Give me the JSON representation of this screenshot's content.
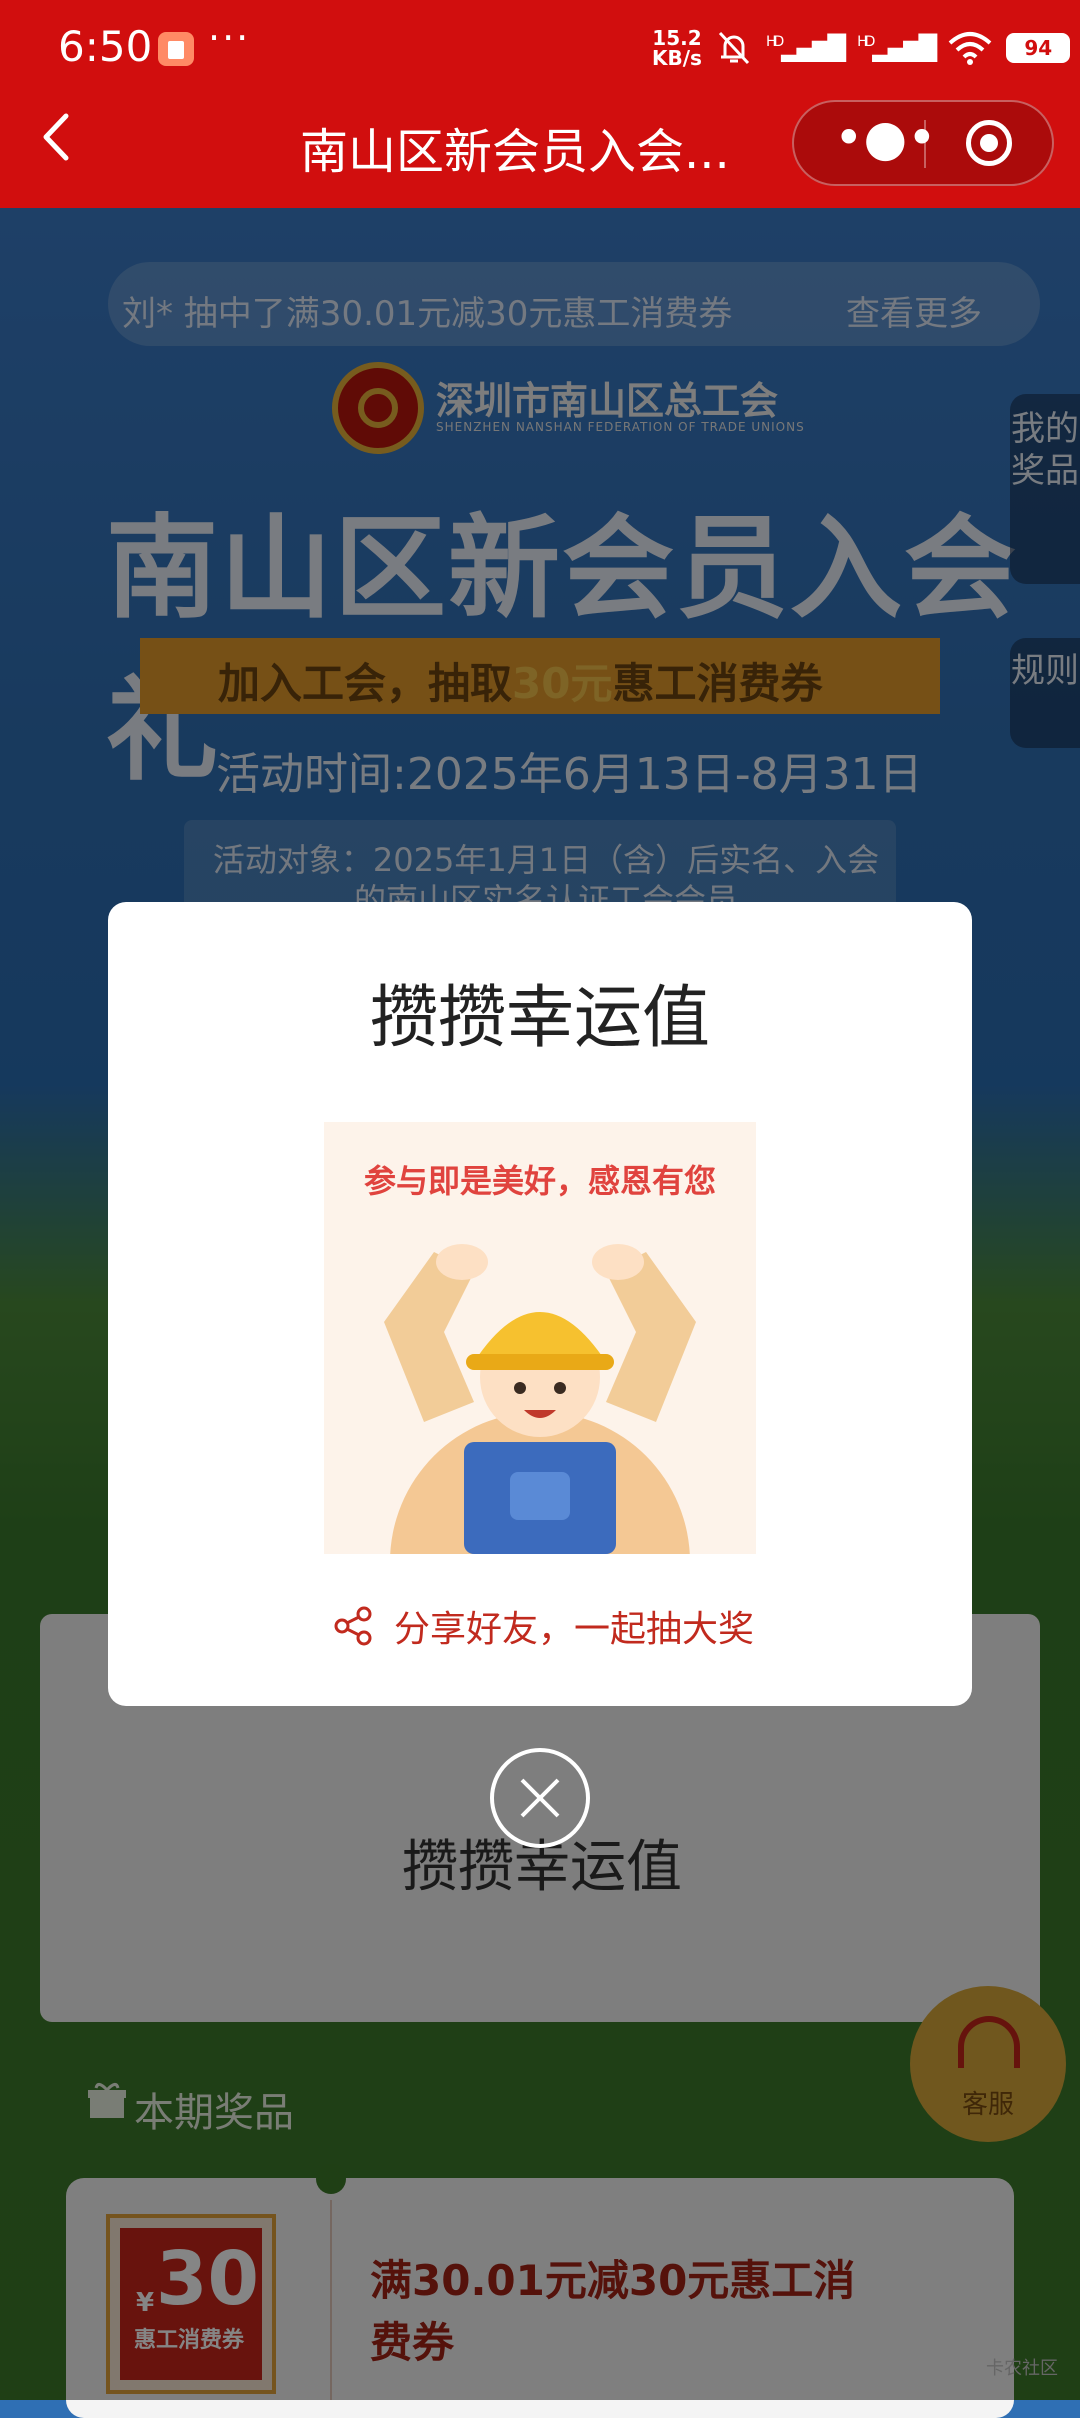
{
  "status_bar": {
    "time": "6:50",
    "net_speed_top": "15.2",
    "net_speed_unit": "KB/s",
    "signal_1_label": "HD",
    "signal_2_label": "HD",
    "battery": "94"
  },
  "header": {
    "title": "南山区新会员入会..."
  },
  "background": {
    "ticker": {
      "text": "刘* 抽中了满30.01元减30元惠工消费券",
      "more": "查看更多"
    },
    "org_name": "深圳市南山区总工会",
    "org_name_en": "SHENZHEN NANSHAN FEDERATION OF TRADE UNIONS",
    "hero_title": "南山区新会员入会礼",
    "banner": {
      "before": "加入工会，抽取",
      "highlight": "30元",
      "after": "惠工消费券"
    },
    "activity_time": "活动时间:2025年6月13日-8月31日",
    "target": "活动对象：2025年1月1日（含）后实名、入会的南山区实名认证工会会员",
    "side_prizes": "我的奖品",
    "side_rules": "规则",
    "card_title": "攒攒幸运值",
    "prize_heading": "本期奖品",
    "customer_service": "客服",
    "coupon": {
      "yen": "¥",
      "amount": "30",
      "label": "惠工消费券"
    },
    "prize_name": "满30.01元减30元惠工消费券",
    "watermark": "卡农社区"
  },
  "modal": {
    "title": "攒攒幸运值",
    "image_caption": "参与即是美好，感恩有您",
    "share_text": "分享好友，一起抽大奖"
  },
  "colors": {
    "brand_red": "#d10e0e",
    "accent_red": "#c12a1e",
    "gold": "#e2992b"
  }
}
